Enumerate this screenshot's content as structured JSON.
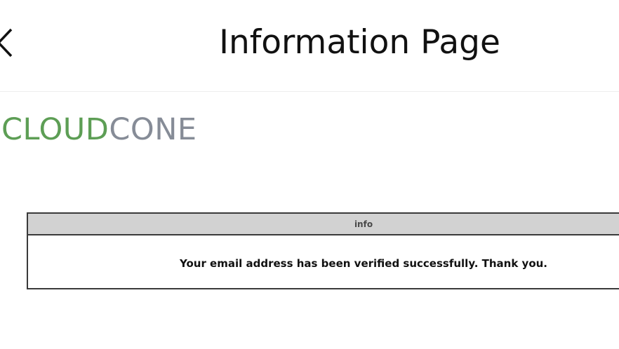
{
  "header": {
    "back_icon": "chevron-left-icon",
    "title": "Information Page"
  },
  "logo": {
    "part1": "CLOUD",
    "part2": "CONE",
    "colors": {
      "cloud": "#5d9e55",
      "cone": "#868c97"
    }
  },
  "info_panel": {
    "heading": "info",
    "message": "Your email address has been verified successfully. Thank you."
  }
}
